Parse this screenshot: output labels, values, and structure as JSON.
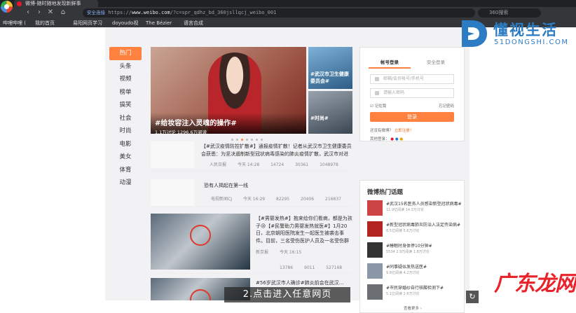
{
  "browser": {
    "tab_title": "微博-随时随地发现新鲜事",
    "nav": {
      "back": "‹",
      "forward": "›",
      "reload": "✕",
      "home": "⌂"
    },
    "address": {
      "secure_label": "安全连接",
      "prefix": "https://",
      "host": "www.weibo.com",
      "path": "/?c=spr_qdhz_bd_360jsllqcj_weibo_001"
    },
    "search_placeholder": "360搜索",
    "bookmarks": [
      "哔哩哔哩 (",
      "我的首页",
      "易阳网页学习",
      "doyoudo视",
      "The Bézier",
      "语言合成"
    ]
  },
  "left_nav": [
    "热门",
    "头条",
    "视频",
    "榜单",
    "搞笑",
    "社会",
    "时尚",
    "电影",
    "美女",
    "体育",
    "动漫"
  ],
  "hero": {
    "title": "#给妆容注入灵魂的操作#",
    "stats": "1.1万讨论    1296.6万阅读"
  },
  "side_cards": [
    {
      "title": "#武汉市卫生健康委员会#"
    },
    {
      "title": "#时尚#"
    }
  ],
  "feed": [
    {
      "tag": "【#武汉疫情防控#】",
      "text": "【#武汉疫情防控扩散#】通报疫情扩散！记者从武汉市卫生健康委员会获悉：为坚决遏制新型冠状病毒感染的肺炎疫情扩散，武汉市对进出汉人员严格管控…",
      "source": "人民日报",
      "time": "今天 14:28",
      "reposts": "14724",
      "comments": "30361",
      "likes": "1048978"
    },
    {
      "text": "恐有人揭起在第一线",
      "source": "电视新闻CJ",
      "time": "今天 16:29",
      "reposts": "82295",
      "comments": "20406",
      "likes": "216837"
    },
    {
      "tag": "【#男婴发热#】",
      "text": "【#男婴发热#】抱来给你们看病，都是为孩子😢【#民警助力男婴发热就医#】1月20日，北京朝阳医院发生一起医生被袭击事件。目前，三名受伤医护人员及一名受伤群众正在医…",
      "source": "新京报",
      "time": "今天 16:15",
      "reposts": "13786",
      "comments": "9011",
      "likes": "527168"
    },
    {
      "tag": "【#56岁武汉市人确诊#】",
      "text": "#56岁武汉市人确诊#肺炎前会在武汉…",
      "source": "",
      "time": "",
      "reposts": "",
      "comments": "",
      "likes": ""
    }
  ],
  "login": {
    "tab_account": "帐号登录",
    "tab_secure": "安全登录",
    "username_placeholder": "邮箱/会员帐号/手机号",
    "password_placeholder": "请输入密码",
    "remember": "记住我",
    "forgot": "忘记密码",
    "login_button": "登录",
    "no_account": "还没有微博？",
    "register": "立即注册！",
    "other_login": "其他登录："
  },
  "hot_topics": {
    "heading": "微博热门话题",
    "items": [
      {
        "title": "#武汉15名医务人员感染新型冠状病毒#",
        "stats": "11.9亿阅读 14.3万讨论"
      },
      {
        "title": "#新型冠状病毒肺炎防治入法定传染病#",
        "stats": "8.5亿阅读 5.6万讨论"
      },
      {
        "title": "#睡眠时身体停10分钟#",
        "stats": "5534 2.9万阅读 1.8万讨论"
      },
      {
        "title": "#同事疑似发热送医#",
        "stats": "9.8亿阅读 4.2万讨论"
      },
      {
        "title": "#市民穿婚纱自行核酸检测下#",
        "stats": "5.1亿阅读 2.6万讨论"
      }
    ],
    "more": "查看更多 ›"
  },
  "caption": "2.点击进入任意网页",
  "watermark_top": {
    "cn": "懂视生活",
    "en": "51DONGSHI.COM"
  },
  "watermark_bottom": "广东龙网",
  "colors": {
    "accent": "#ff8140",
    "weibo_red": "#e6162d",
    "watermark_blue": "#2c7cc4"
  }
}
